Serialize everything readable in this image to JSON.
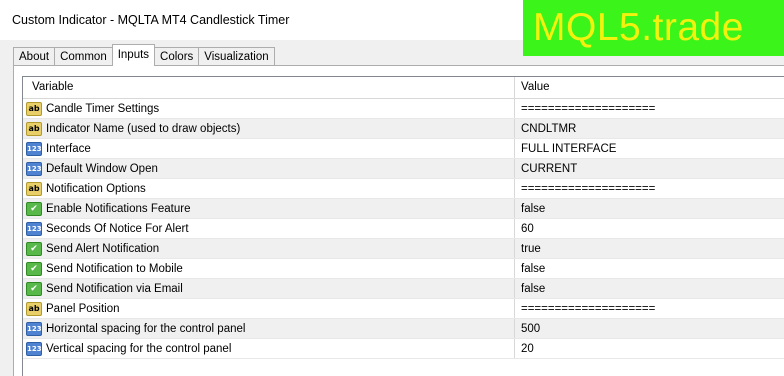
{
  "window": {
    "title": "Custom Indicator - MQLTA MT4 Candlestick Timer"
  },
  "watermark": "MQL5.trade",
  "tabs": [
    {
      "label": "About",
      "active": false
    },
    {
      "label": "Common",
      "active": false
    },
    {
      "label": "Inputs",
      "active": true
    },
    {
      "label": "Colors",
      "active": false
    },
    {
      "label": "Visualization",
      "active": false
    }
  ],
  "table": {
    "columns": {
      "variable": "Variable",
      "value": "Value"
    },
    "rows": [
      {
        "icon": "ab",
        "variable": "Candle Timer Settings",
        "value": "===================="
      },
      {
        "icon": "ab",
        "variable": "Indicator Name (used to draw objects)",
        "value": "CNDLTMR"
      },
      {
        "icon": "123",
        "variable": "Interface",
        "value": "FULL INTERFACE"
      },
      {
        "icon": "123",
        "variable": "Default Window Open",
        "value": "CURRENT"
      },
      {
        "icon": "ab",
        "variable": "Notification Options",
        "value": "===================="
      },
      {
        "icon": "bool",
        "variable": "Enable Notifications Feature",
        "value": "false"
      },
      {
        "icon": "123",
        "variable": "Seconds Of Notice For Alert",
        "value": "60"
      },
      {
        "icon": "bool",
        "variable": "Send Alert Notification",
        "value": "true"
      },
      {
        "icon": "bool",
        "variable": "Send Notification to Mobile",
        "value": "false"
      },
      {
        "icon": "bool",
        "variable": "Send Notification via Email",
        "value": "false"
      },
      {
        "icon": "ab",
        "variable": "Panel Position",
        "value": "===================="
      },
      {
        "icon": "123",
        "variable": "Horizontal spacing for the control panel",
        "value": "500"
      },
      {
        "icon": "123",
        "variable": "Vertical spacing for the control panel",
        "value": "20"
      }
    ]
  },
  "icon_names": {
    "ab": "string-type-icon",
    "123": "number-type-icon",
    "bool": "boolean-type-icon"
  },
  "colors": {
    "watermark_bg": "#3bf51a",
    "watermark_text": "#f3f20f",
    "row_alt": "#f0f0f0"
  }
}
